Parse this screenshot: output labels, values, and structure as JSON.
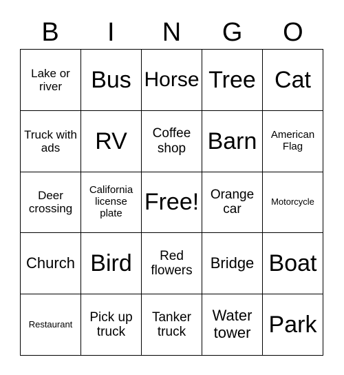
{
  "card": {
    "header_letters": [
      "B",
      "I",
      "N",
      "G",
      "O"
    ],
    "grid": {
      "columns": 5,
      "rows": 5,
      "border_color": "#000000",
      "background_color": "#ffffff",
      "text_color": "#000000"
    },
    "cells": [
      [
        {
          "label": "Lake or river",
          "size": "fs-xs"
        },
        {
          "label": "Bus",
          "size": "fs-xl"
        },
        {
          "label": "Horse",
          "size": "fs-lg"
        },
        {
          "label": "Tree",
          "size": "fs-xl"
        },
        {
          "label": "Cat",
          "size": "fs-xl"
        }
      ],
      [
        {
          "label": "Truck with ads",
          "size": "fs-xs"
        },
        {
          "label": "RV",
          "size": "fs-xl"
        },
        {
          "label": "Coffee shop",
          "size": "fs-sm"
        },
        {
          "label": "Barn",
          "size": "fs-xl"
        },
        {
          "label": "American Flag",
          "size": "fs-xxs"
        }
      ],
      [
        {
          "label": "Deer crossing",
          "size": "fs-xs"
        },
        {
          "label": "California license plate",
          "size": "fs-xxs"
        },
        {
          "label": "Free!",
          "size": "fs-xl"
        },
        {
          "label": "Orange car",
          "size": "fs-sm"
        },
        {
          "label": "Motorcycle",
          "size": "fs-tiny"
        }
      ],
      [
        {
          "label": "Church",
          "size": "fs-md"
        },
        {
          "label": "Bird",
          "size": "fs-xl"
        },
        {
          "label": "Red flowers",
          "size": "fs-sm"
        },
        {
          "label": "Bridge",
          "size": "fs-md"
        },
        {
          "label": "Boat",
          "size": "fs-xl"
        }
      ],
      [
        {
          "label": "Restaurant",
          "size": "fs-tiny"
        },
        {
          "label": "Pick up truck",
          "size": "fs-sm"
        },
        {
          "label": "Tanker truck",
          "size": "fs-sm"
        },
        {
          "label": "Water tower",
          "size": "fs-md"
        },
        {
          "label": "Park",
          "size": "fs-xl"
        }
      ]
    ],
    "free_space": {
      "row": 2,
      "column": 2,
      "label": "Free!"
    }
  }
}
